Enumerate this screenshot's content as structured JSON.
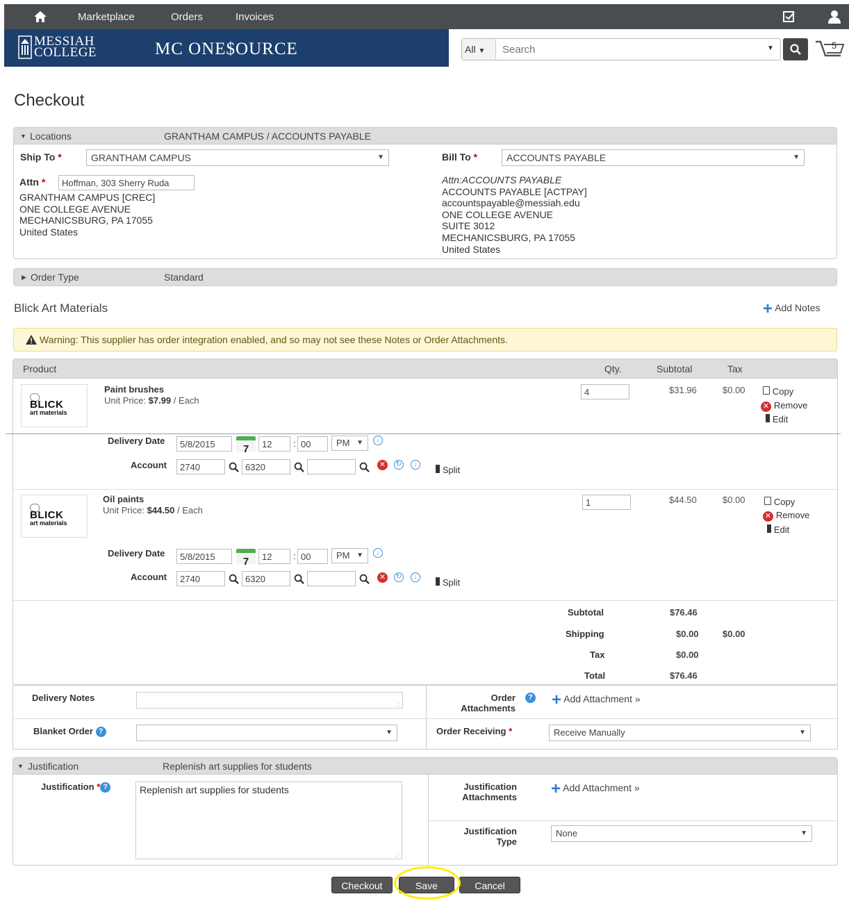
{
  "topnav": {
    "marketplace": "Marketplace",
    "orders": "Orders",
    "invoices": "Invoices"
  },
  "brand": {
    "college_line1": "MESSIAH",
    "college_line2": "COLLEGE",
    "app_name": "MC ONE$OURCE"
  },
  "search": {
    "category": "All",
    "placeholder": "Search",
    "cart_count": "5"
  },
  "page_title": "Checkout",
  "locations": {
    "header": "Locations",
    "summary": "GRANTHAM CAMPUS / ACCOUNTS PAYABLE",
    "ship_to_label": "Ship To",
    "ship_to_value": "GRANTHAM CAMPUS",
    "bill_to_label": "Bill To",
    "bill_to_value": "ACCOUNTS PAYABLE",
    "attn_label": "Attn",
    "attn_value": "Hoffman, 303 Sherry Ruda",
    "ship_address": [
      "GRANTHAM CAMPUS [CREC]",
      "ONE COLLEGE AVENUE",
      "MECHANICSBURG,  PA  17055",
      "United States"
    ],
    "bill_attn": "Attn:ACCOUNTS PAYABLE",
    "bill_address": [
      "ACCOUNTS PAYABLE [ACTPAY]",
      "accountspayable@messiah.edu",
      "ONE COLLEGE AVENUE",
      "SUITE 3012",
      "MECHANICSBURG,  PA  17055",
      "United States"
    ]
  },
  "order_type": {
    "header": "Order Type",
    "value": "Standard"
  },
  "supplier": {
    "name": "Blick Art Materials",
    "add_notes": "Add Notes",
    "warning": "Warning: This supplier has order integration enabled, and so may not see these Notes or Order Attachments."
  },
  "table_headers": {
    "product": "Product",
    "qty": "Qty.",
    "subtotal": "Subtotal",
    "tax": "Tax"
  },
  "logo": {
    "brand": "BLICK",
    "tagline": "art materials"
  },
  "items": [
    {
      "name": "Paint brushes",
      "unit_price_label": "Unit Price:",
      "unit_price": "$7.99",
      "unit": "/ Each",
      "qty": "4",
      "subtotal": "$31.96",
      "tax": "$0.00",
      "delivery_date": "5/8/2015",
      "hour": "12",
      "minute": "00",
      "ampm": "PM",
      "account1": "2740",
      "account2": "6320",
      "account3": ""
    },
    {
      "name": "Oil paints",
      "unit_price_label": "Unit Price:",
      "unit_price": "$44.50",
      "unit": "/ Each",
      "qty": "1",
      "subtotal": "$44.50",
      "tax": "$0.00",
      "delivery_date": "5/8/2015",
      "hour": "12",
      "minute": "00",
      "ampm": "PM",
      "account1": "2740",
      "account2": "6320",
      "account3": ""
    }
  ],
  "item_actions": {
    "copy": "Copy",
    "remove": "Remove",
    "edit": "Edit",
    "delivery_date_label": "Delivery Date",
    "account_label": "Account",
    "split": "Split",
    "calendar_day": "7"
  },
  "totals": {
    "subtotal_label": "Subtotal",
    "subtotal": "$76.46",
    "shipping_label": "Shipping",
    "shipping": "$0.00",
    "shipping_tax": "$0.00",
    "tax_label": "Tax",
    "tax": "$0.00",
    "total_label": "Total",
    "total": "$76.46"
  },
  "order_fields": {
    "delivery_notes": "Delivery Notes",
    "order_attachments_1": "Order",
    "order_attachments_2": "Attachments",
    "add_attachment": "Add Attachment »",
    "blanket_order": "Blanket Order",
    "order_receiving": "Order Receiving",
    "order_receiving_value": "Receive Manually"
  },
  "justification": {
    "header": "Justification",
    "summary": "Replenish art supplies for students",
    "label": "Justification",
    "value": "Replenish art supplies for students",
    "attachments_1": "Justification",
    "attachments_2": "Attachments",
    "add_attachment": "Add Attachment »",
    "type_1": "Justification",
    "type_2": "Type",
    "type_value": "None"
  },
  "buttons": {
    "checkout": "Checkout",
    "save": "Save",
    "cancel": "Cancel"
  },
  "colors": {
    "highlight": "#ffee00",
    "navy": "#1c3f6e",
    "accent": "#2a7fd6"
  }
}
